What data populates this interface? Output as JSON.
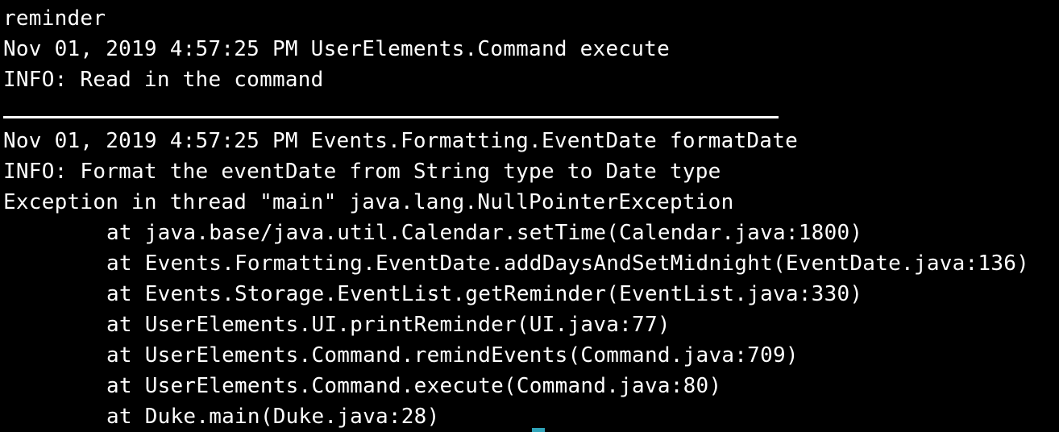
{
  "terminal": {
    "command": "reminder",
    "log1": {
      "header": "Nov 01, 2019 4:57:25 PM UserElements.Command execute",
      "message": "INFO: Read in the command"
    },
    "log2": {
      "header": "Nov 01, 2019 4:57:25 PM Events.Formatting.EventDate formatDate",
      "message": "INFO: Format the eventDate from String type to Date type"
    },
    "exception": "Exception in thread \"main\" java.lang.NullPointerException",
    "stack": [
      "at java.base/java.util.Calendar.setTime(Calendar.java:1800)",
      "at Events.Formatting.EventDate.addDaysAndSetMidnight(EventDate.java:136)",
      "at Events.Storage.EventList.getReminder(EventList.java:330)",
      "at UserElements.UI.printReminder(UI.java:77)",
      "at UserElements.Command.remindEvents(Command.java:709)",
      "at UserElements.Command.execute(Command.java:80)",
      "at Duke.main(Duke.java:28)"
    ]
  },
  "colors": {
    "background": "#000000",
    "text": "#ffffff",
    "cursor": "#2fa3b8"
  }
}
